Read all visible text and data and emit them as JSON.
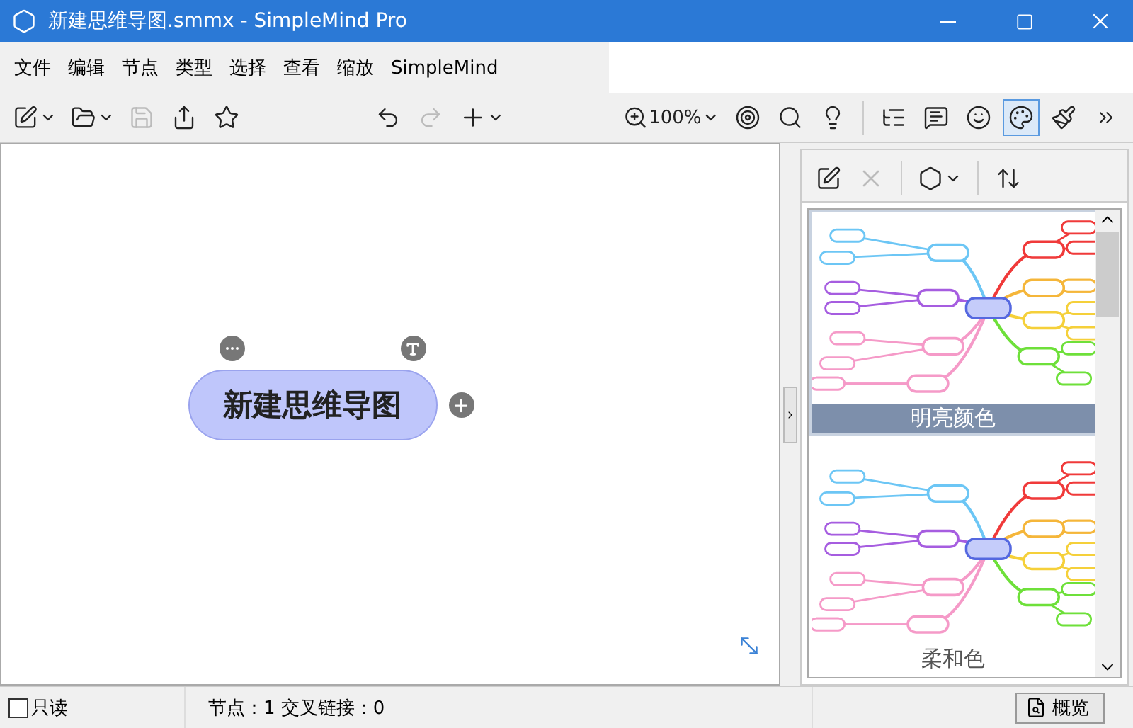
{
  "window": {
    "title": "新建思维导图.smmx - SimpleMind Pro"
  },
  "menu": [
    "文件",
    "编辑",
    "节点",
    "类型",
    "选择",
    "查看",
    "缩放",
    "SimpleMind"
  ],
  "toolbar": {
    "zoom": "100%",
    "tools": [
      {
        "kind": "tree",
        "selected": false
      },
      {
        "kind": "note",
        "selected": false
      },
      {
        "kind": "smile",
        "selected": false
      },
      {
        "kind": "palette",
        "selected": true
      },
      {
        "kind": "brush",
        "selected": false
      }
    ]
  },
  "canvas": {
    "central_node": "新建思维导图"
  },
  "styles": [
    {
      "label": "明亮颜色",
      "selected": true
    },
    {
      "label": "柔和色",
      "selected": false
    }
  ],
  "status_bar": {
    "readonly": {
      "label": "只读",
      "checked": false
    },
    "counts": "节点：1 交叉链接：0",
    "overview": "概览"
  }
}
